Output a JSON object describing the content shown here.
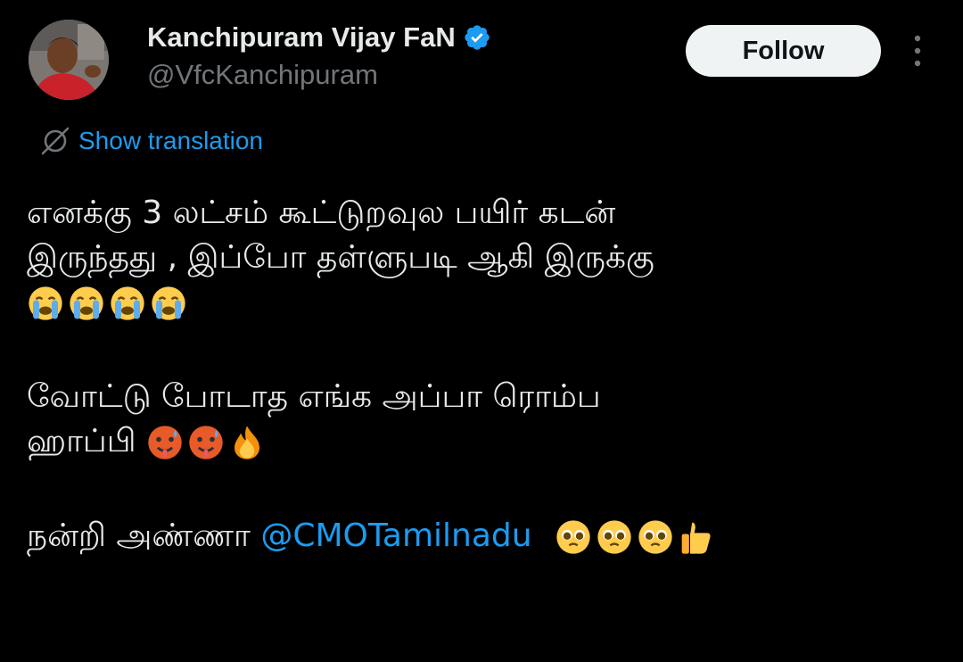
{
  "tweet": {
    "author": {
      "display_name": "Kanchipuram Vijay FaN",
      "handle": "@VfcKanchipuram",
      "verified": true
    },
    "follow_label": "Follow",
    "translation_label": "Show translation",
    "body": {
      "line1": "எனக்கு 3 லட்சம் கூட்டுறவுல பயிர் கடன்",
      "line2": "இருந்தது , இப்போ தள்ளுபடி ஆகி இருக்கு",
      "line3_emojis": [
        "crying-face",
        "crying-face",
        "crying-face",
        "crying-face"
      ],
      "line4": "வோட்டு போடாத எங்க அப்பா ரொம்ப",
      "line5_text": "ஹாப்பி",
      "line5_emojis": [
        "hot-face",
        "hot-face",
        "fire"
      ],
      "line6_text": "நன்றி அண்ணா",
      "mention": "@CMOTamilnadu",
      "line6_emojis": [
        "pleading-face",
        "pleading-face",
        "pleading-face",
        "thumbs-up"
      ]
    }
  },
  "colors": {
    "background": "#000000",
    "text": "#e7e9ea",
    "secondary": "#71767b",
    "accent": "#1d9bf0",
    "follow_bg": "#eff3f4"
  }
}
